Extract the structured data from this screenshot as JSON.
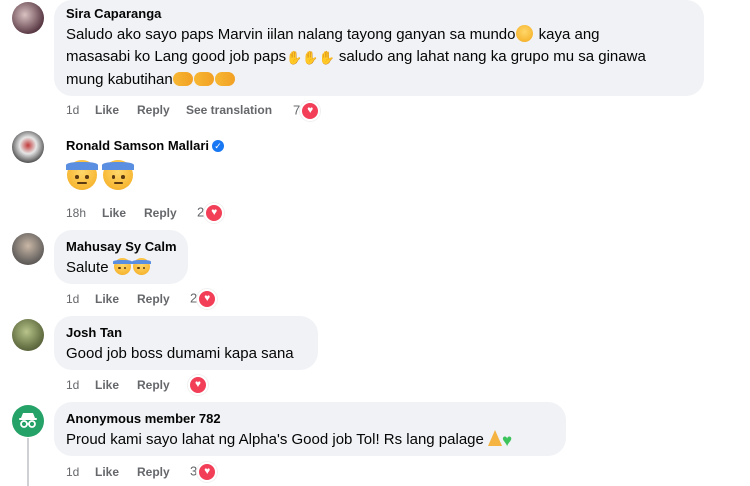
{
  "comments": [
    {
      "author": "Sira Caparanga",
      "line1": "Saludo ako sayo paps Marvin iilan nalang tayong ganyan sa mundo",
      "line1b": " kaya ang",
      "line2": "masasabi ko Lang good job paps",
      "line2b": " saludo ang lahat nang ka grupo mu sa ginawa",
      "line3": "mung kabutihan",
      "time": "1d",
      "like": "Like",
      "reply": "Reply",
      "translate": "See translation",
      "reactions": "7"
    },
    {
      "author": "Ronald Samson Mallari",
      "time": "18h",
      "like": "Like",
      "reply": "Reply",
      "reactions": "2"
    },
    {
      "author": "Mahusay Sy Calm",
      "text": "Salute",
      "time": "1d",
      "like": "Like",
      "reply": "Reply",
      "reactions": "2"
    },
    {
      "author": "Josh Tan",
      "text": "Good job boss dumami kapa sana",
      "time": "1d",
      "like": "Like",
      "reply": "Reply"
    },
    {
      "author": "Anonymous member 782",
      "text": "Proud kami sayo lahat ng Alpha's Good job Tol! Rs lang palage",
      "time": "1d",
      "like": "Like",
      "reply": "Reply",
      "reactions": "3"
    }
  ],
  "icons": {
    "heart": "heart-reaction-icon",
    "salute": "saluting-face-emoji",
    "clap": "clapping-hands-emoji",
    "handshake": "handshake-emoji",
    "pray": "folded-hands-emoji",
    "green_heart": "green-heart-emoji",
    "verified": "verified-badge-icon"
  },
  "colors": {
    "reaction_heart": "#f33e58",
    "verified": "#1877f2",
    "bubble": "#f0f2f5",
    "meta": "#65676b"
  }
}
